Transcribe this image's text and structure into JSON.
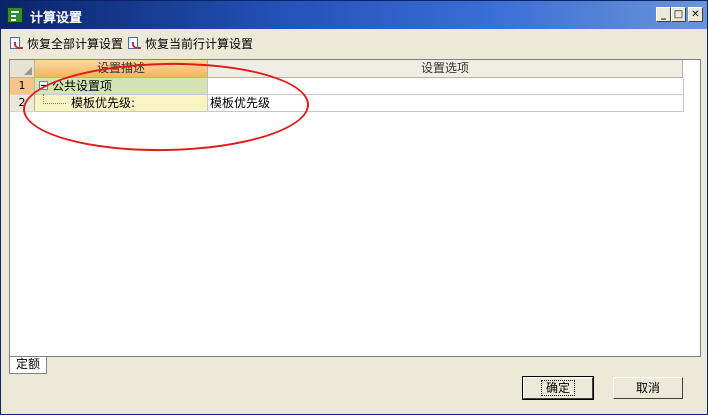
{
  "window": {
    "title": "计算设置"
  },
  "toolbar": {
    "restore_all_label": "恢复全部计算设置",
    "restore_current_label": "恢复当前行计算设置"
  },
  "grid": {
    "columns": [
      "设置描述",
      "设置选项"
    ],
    "rows": [
      {
        "num": "1",
        "desc": "公共设置项",
        "option": ""
      },
      {
        "num": "2",
        "desc": "模板优先级:",
        "option": "模板优先级"
      }
    ]
  },
  "tabs": [
    "定额"
  ],
  "buttons": {
    "ok": "确定",
    "cancel": "取消"
  },
  "window_buttons": {
    "minimize": "_",
    "maximize": "□",
    "close": "✕"
  },
  "colors": {
    "title_bar": "#0a246a",
    "header_active": "#f5b45f",
    "group_row": "#d3e3b5",
    "child_row": "#f9f4c2",
    "annotation": "#e11a1a"
  }
}
